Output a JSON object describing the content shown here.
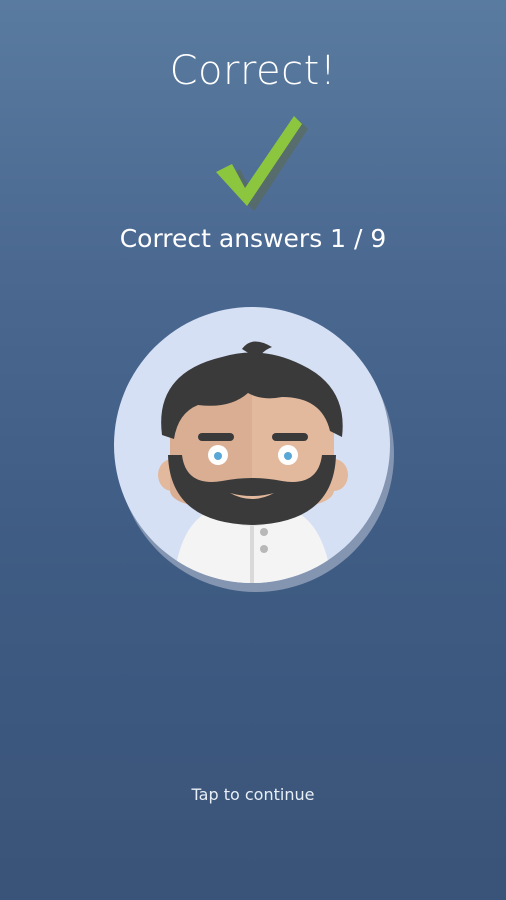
{
  "result": {
    "title": "Correct!",
    "score_label": "Correct answers 1 / 9",
    "tap_hint": "Tap to continue"
  },
  "icons": {
    "checkmark": "check-icon",
    "avatar": "bearded-man-avatar"
  },
  "colors": {
    "background_top": "#5a7ba0",
    "background_bottom": "#3a5378",
    "check_green": "#8cc63f",
    "avatar_circle": "#d6e0f5",
    "hair_beard": "#3a3a3a",
    "skin": "#e3b99e",
    "shirt": "#f4f4f4"
  }
}
